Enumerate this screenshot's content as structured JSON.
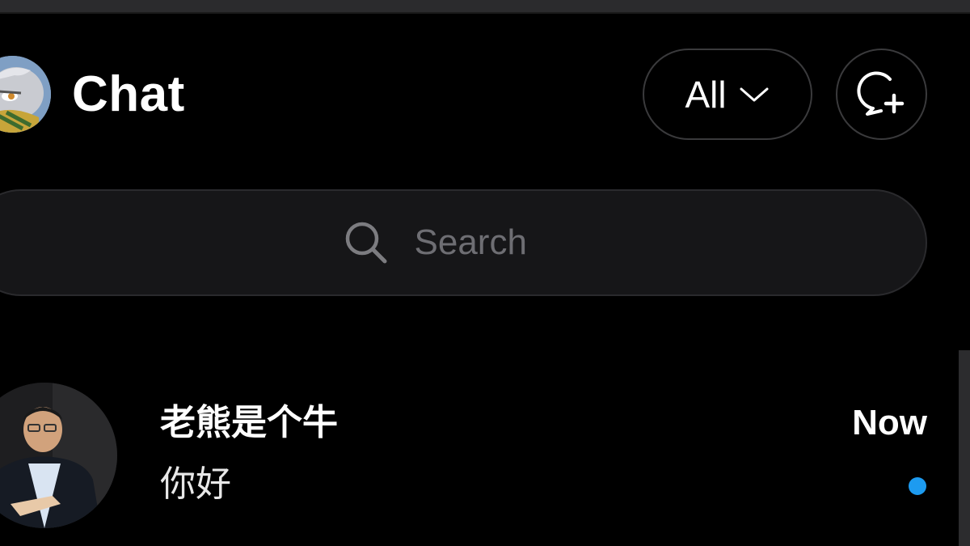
{
  "header": {
    "title": "Chat",
    "filter_label": "All"
  },
  "icons": {
    "profile": "cartoon-avatar",
    "filter_chevron": "chevron-down-icon",
    "new_chat": "chat-bubble-plus-icon",
    "search": "search-icon"
  },
  "search": {
    "placeholder": "Search",
    "value": ""
  },
  "conversations": [
    {
      "name": "老熊是个牛",
      "preview": "你好",
      "time": "Now",
      "unread": true
    }
  ],
  "colors": {
    "background": "#000000",
    "pill_border": "#3a3a3c",
    "search_bg": "#161618",
    "placeholder": "#6e6e73",
    "unread_dot": "#1d9bf0"
  }
}
